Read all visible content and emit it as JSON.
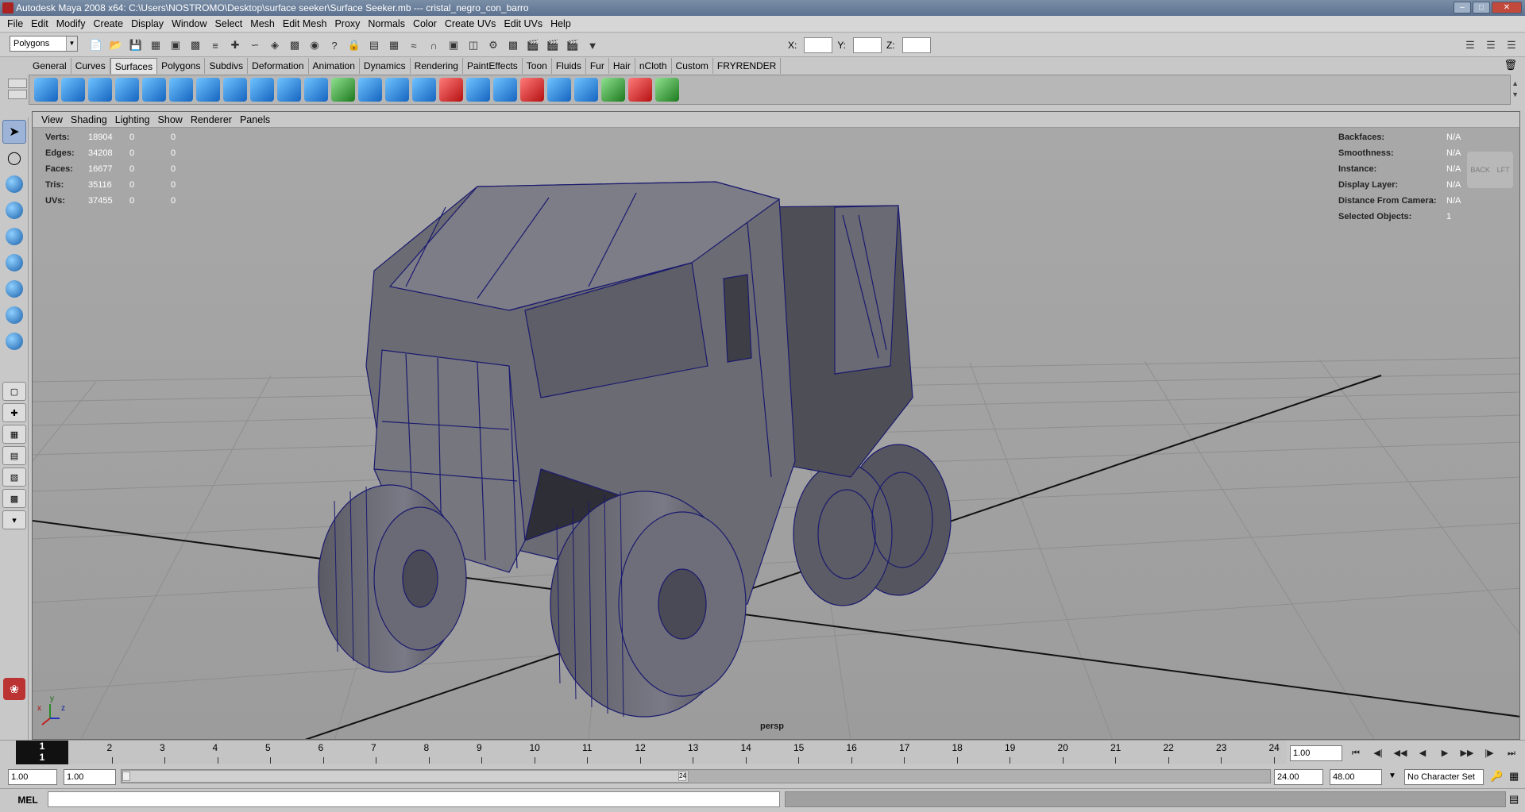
{
  "window": {
    "title": "Autodesk Maya 2008 x64: C:\\Users\\NOSTROMO\\Desktop\\surface seeker\\Surface Seeker.mb  ---  cristal_negro_con_barro"
  },
  "menubar": [
    "File",
    "Edit",
    "Modify",
    "Create",
    "Display",
    "Window",
    "Select",
    "Mesh",
    "Edit Mesh",
    "Proxy",
    "Normals",
    "Color",
    "Create UVs",
    "Edit UVs",
    "Help"
  ],
  "toolbar": {
    "mode": "Polygons",
    "x_label": "X:",
    "y_label": "Y:",
    "z_label": "Z:"
  },
  "shelf_tabs": [
    "General",
    "Curves",
    "Surfaces",
    "Polygons",
    "Subdivs",
    "Deformation",
    "Animation",
    "Dynamics",
    "Rendering",
    "PaintEffects",
    "Toon",
    "Fluids",
    "Fur",
    "Hair",
    "nCloth",
    "Custom",
    "FRYRENDER"
  ],
  "shelf_active": "Surfaces",
  "viewport": {
    "menu": [
      "View",
      "Shading",
      "Lighting",
      "Show",
      "Renderer",
      "Panels"
    ],
    "camera": "persp",
    "hud_left": [
      {
        "label": "Verts:",
        "v1": "18904",
        "v2": "0",
        "v3": "0"
      },
      {
        "label": "Edges:",
        "v1": "34208",
        "v2": "0",
        "v3": "0"
      },
      {
        "label": "Faces:",
        "v1": "16677",
        "v2": "0",
        "v3": "0"
      },
      {
        "label": "Tris:",
        "v1": "35116",
        "v2": "0",
        "v3": "0"
      },
      {
        "label": "UVs:",
        "v1": "37455",
        "v2": "0",
        "v3": "0"
      }
    ],
    "hud_right": [
      {
        "label": "Backfaces:",
        "val": "N/A"
      },
      {
        "label": "Smoothness:",
        "val": "N/A"
      },
      {
        "label": "Instance:",
        "val": "N/A"
      },
      {
        "label": "Display Layer:",
        "val": "N/A"
      },
      {
        "label": "Distance From Camera:",
        "val": "N/A"
      },
      {
        "label": "Selected Objects:",
        "val": "1"
      }
    ],
    "viewcube_back": "BACK",
    "viewcube_left": "LFT",
    "axis_y": "y",
    "axis_x": "x",
    "axis_z": "z"
  },
  "timeline": {
    "current_frame": "1",
    "current_frame_b": "1",
    "ticks": [
      "2",
      "3",
      "4",
      "5",
      "6",
      "7",
      "8",
      "9",
      "10",
      "11",
      "12",
      "13",
      "14",
      "15",
      "16",
      "17",
      "18",
      "19",
      "20",
      "21",
      "22",
      "23",
      "24"
    ],
    "current_time": "1.00"
  },
  "range": {
    "start": "1.00",
    "start2": "1.00",
    "end": "24.00",
    "end2": "48.00",
    "knob_label": "24",
    "character_set": "No Character Set"
  },
  "command": {
    "mel_label": "MEL"
  }
}
